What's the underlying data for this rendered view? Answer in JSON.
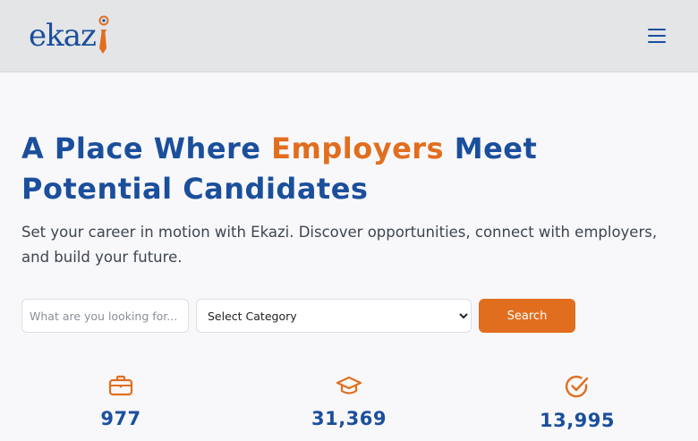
{
  "header": {
    "logo_text": "ekaz",
    "logo_alt": "ekazi",
    "menu_icon": "hamburger-menu-icon"
  },
  "hero": {
    "title_part1": "A Place Where ",
    "title_accent": "Employers",
    "title_part2": " Meet Potential Candidates",
    "subtitle": "Set your career in motion with Ekazi. Discover opportunities, connect with employers, and build your future."
  },
  "search": {
    "placeholder": "What are you looking for...",
    "category_label": "Select Category",
    "button_label": "Search"
  },
  "stats": [
    {
      "icon": "briefcase-icon",
      "value": "977"
    },
    {
      "icon": "graduation-cap-icon",
      "value": "31,369"
    },
    {
      "icon": "check-circle-icon",
      "value": "13,995"
    }
  ],
  "colors": {
    "primary": "#1b4f9c",
    "accent": "#e16e1f",
    "header_bg": "#e4e5e7",
    "page_bg": "#f8f8fa"
  }
}
